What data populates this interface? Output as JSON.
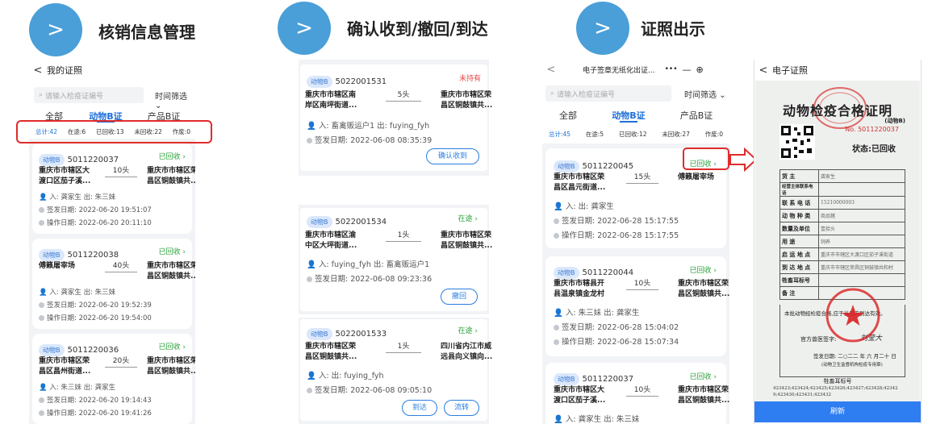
{
  "steps": [
    {
      "arrow": ">",
      "title": "核销信息管理"
    },
    {
      "arrow": ">",
      "title": "确认收到/撤回/到达"
    },
    {
      "arrow": ">",
      "title": "证照出示"
    }
  ],
  "panel1": {
    "header_title": "我的证照",
    "search_placeholder": "请输入检疫证编号",
    "time_filter": "时间筛选",
    "tabs": [
      "全部",
      "动物B证",
      "产品B证"
    ],
    "stats": [
      "总计:42",
      "在途:6",
      "已回收:13",
      "未回收:22",
      "作废:0"
    ],
    "cards": [
      {
        "badge": "动物B",
        "no": "5011220037",
        "status": "已回收",
        "from": [
          "重庆市市辖区大",
          "渡口区茄子溪..."
        ],
        "qty": "10头",
        "to": [
          "重庆市市辖区荣",
          "昌区铜鼓镇共..."
        ],
        "people": "入: 龚家生  出: 朱三妹",
        "issue": "签发日期: 2022-06-20 19:51:07",
        "op": "操作日期: 2022-06-20 20:11:10"
      },
      {
        "badge": "动物B",
        "no": "5011220038",
        "status": "已回收",
        "from": [
          "傅籁屠宰场"
        ],
        "qty": "40头",
        "to": [
          "重庆市市辖区荣",
          "昌区铜鼓镇共..."
        ],
        "people": "入: 龚家生  出: 朱三妹",
        "issue": "签发日期: 2022-06-20 19:52:39",
        "op": "操作日期: 2022-06-20 19:54:00"
      },
      {
        "badge": "动物B",
        "no": "5011220036",
        "status": "已回收",
        "from": [
          "重庆市市辖区荣",
          "昌区昌州街道..."
        ],
        "qty": "20头",
        "to": [
          "重庆市市辖区荣",
          "昌区铜鼓镇共..."
        ],
        "people": "入: 朱三妹  出: 龚家生",
        "issue": "签发日期: 2022-06-20 19:14:43",
        "op": "操作日期: 2022-06-20 19:41:26"
      }
    ]
  },
  "panel2": {
    "cards": [
      {
        "badge": "动物B",
        "no": "5022001531",
        "status": "未持有",
        "from": [
          "重庆市市辖区南",
          "岸区南坪街道..."
        ],
        "qty": "5头",
        "to": [
          "重庆市市辖区荣",
          "昌区铜鼓镇共..."
        ],
        "people": "入: 畜禽贩运户1  出: fuying_fyh",
        "issue": "签发日期: 2022-06-08 08:35:39",
        "buttons": [
          "确认收到"
        ]
      },
      {
        "badge": "动物B",
        "no": "5022001534",
        "status": "在途",
        "from": [
          "重庆市市辖区渝",
          "中区大坪街道..."
        ],
        "qty": "1头",
        "to": [
          "重庆市市辖区荣",
          "昌区铜鼓镇共..."
        ],
        "people": "入: fuying_fyh  出: 畜禽贩运户1",
        "issue": "签发日期: 2022-06-08 09:23:36",
        "buttons": [
          "撤回"
        ]
      },
      {
        "badge": "动物B",
        "no": "5022001533",
        "status": "在途",
        "from": [
          "重庆市市辖区荣",
          "昌区铜鼓镇共..."
        ],
        "qty": "1头",
        "to": [
          "四川省内江市威",
          "远县向义镇向..."
        ],
        "people": "入:  出: fuying_fyh",
        "issue": "签发日期: 2022-06-08 09:05:10",
        "buttons": [
          "到达",
          "流转"
        ]
      }
    ]
  },
  "panel3": {
    "header_title": "电子签章无纸化出证...",
    "header_icons": "•••",
    "search_placeholder": "请输入检疫证编号",
    "time_filter": "时间筛选",
    "tabs": [
      "全部",
      "动物B证",
      "产品B证"
    ],
    "stats": [
      "总计:45",
      "在途:5",
      "已回收:12",
      "未回收:27",
      "作废:0"
    ],
    "cards": [
      {
        "badge": "动物B",
        "no": "5011220045",
        "status": "已回收",
        "from": [
          "重庆市市辖区荣",
          "昌区昌元街道..."
        ],
        "qty": "15头",
        "to": [
          "傅籁屠宰场"
        ],
        "people": "入:  出: 龚家生",
        "issue": "签发日期: 2022-06-28 15:17:55",
        "op": "操作日期: 2022-06-28 15:17:55"
      },
      {
        "badge": "动物B",
        "no": "5011220044",
        "status": "已回收",
        "from": [
          "重庆市市辖县开",
          "县温泉镇金龙村"
        ],
        "qty": "10头",
        "to": [
          "重庆市市辖区荣",
          "昌区铜鼓镇共..."
        ],
        "people": "入: 朱三妹  出: 龚家生",
        "issue": "签发日期: 2022-06-28 15:04:02",
        "op": "操作日期: 2022-06-28 15:07:34"
      },
      {
        "badge": "动物B",
        "no": "5011220037",
        "status": "已回收",
        "from": [
          "重庆市市辖区大",
          "渡口区茄子溪..."
        ],
        "qty": "10头",
        "to": [
          "重庆市市辖区荣",
          "昌区铜鼓镇共..."
        ],
        "people": "入: 龚家生  出: 朱三妹",
        "issue": "",
        "op": ""
      }
    ]
  },
  "panel4": {
    "header_title": "电子证照",
    "cert_title": "动物检疫合格证明",
    "cert_sub": "(动物B)",
    "cert_no": "No. 5011220037",
    "cert_state": "状态:已回收",
    "rows": [
      {
        "k": "货    主",
        "v": "龚家生"
      },
      {
        "k": "经营主体联系电话",
        "v": ""
      },
      {
        "k": "联 系 电 话",
        "v": "15210000003"
      },
      {
        "k": "动 物 种 类",
        "v": "商品猪"
      },
      {
        "k": "数量及单位",
        "v": "壹拾头"
      },
      {
        "k": "用      途",
        "v": "饲养"
      },
      {
        "k": "启 运 地 点",
        "v": "重庆市市辖区大渡口区茄子溪街道"
      },
      {
        "k": "到 达 地 点",
        "v": "重庆市市辖区荣昌区铜鼓镇共和村"
      },
      {
        "k": "牲畜耳标号",
        "v": ""
      },
      {
        "k": "备      注",
        "v": ""
      }
    ],
    "statement": "本批动物经检疫合格,应于当日内到达有效。",
    "vet_sign": "官方兽医签字:",
    "vet_name": "刘莹大",
    "issue_date": "签发日期: 二○二二 年 六 月二十 日",
    "issuer": "(动物卫生监督机构检疫专用章)",
    "eartag_title": "牲畜耳标号",
    "eartag_values": "423423;423424;423425;423426;423427;423428;42342 9;423430;423431;423432",
    "refresh": "刷新"
  },
  "colors": {
    "accent": "#1e6fd9",
    "circle": "#4a9fd8",
    "green": "#2aa23a",
    "red": "#e34b4b",
    "highlight": "#e02b2b"
  }
}
